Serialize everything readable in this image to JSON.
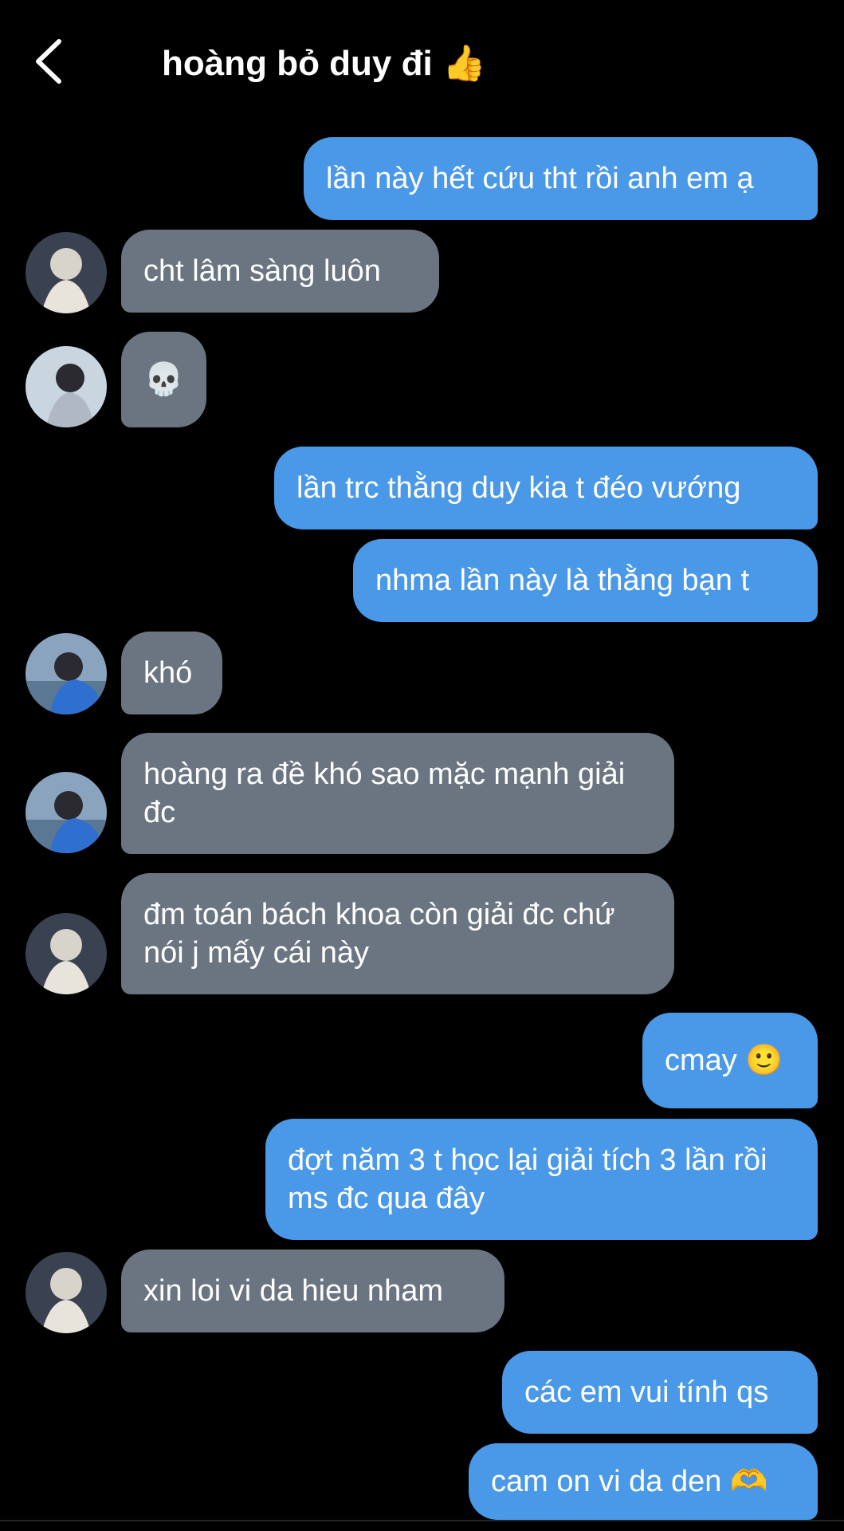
{
  "header": {
    "title": "hoàng bỏ duy đi",
    "title_emoji": "👍"
  },
  "colors": {
    "outgoing_bubble": "#4a98e8",
    "incoming_bubble": "#6b7581",
    "background": "#000000"
  },
  "messages": [
    {
      "direction": "out",
      "text": "lần này hết cứu tht rồi anh em ạ"
    },
    {
      "direction": "in",
      "avatar": "avatar-white-hair",
      "text": "cht lâm sàng luôn"
    },
    {
      "direction": "in",
      "avatar": "avatar-boy-boat",
      "text": "💀"
    },
    {
      "direction": "out",
      "text": "lần trc thằng duy kia t đéo vướng"
    },
    {
      "direction": "out",
      "text": "nhma lần này là thằng bạn t"
    },
    {
      "direction": "in",
      "avatar": "avatar-blue-jacket",
      "text": "khó"
    },
    {
      "direction": "in",
      "avatar": "avatar-blue-jacket",
      "text": "hoàng ra đề khó sao mặc mạnh giải đc"
    },
    {
      "direction": "in",
      "avatar": "avatar-white-hair",
      "text": "đm toán bách khoa còn giải đc chứ nói j mấy cái này"
    },
    {
      "direction": "out",
      "text": "cmay 🙂"
    },
    {
      "direction": "out",
      "text": "đợt năm 3 t học lại giải tích 3 lần rồi ms đc qua đây"
    },
    {
      "direction": "in",
      "avatar": "avatar-white-hair",
      "text": "xin loi vi da hieu nham"
    },
    {
      "direction": "out",
      "text": "các em vui tính qs"
    },
    {
      "direction": "out",
      "text": "cam on vi da den 🫶"
    }
  ]
}
